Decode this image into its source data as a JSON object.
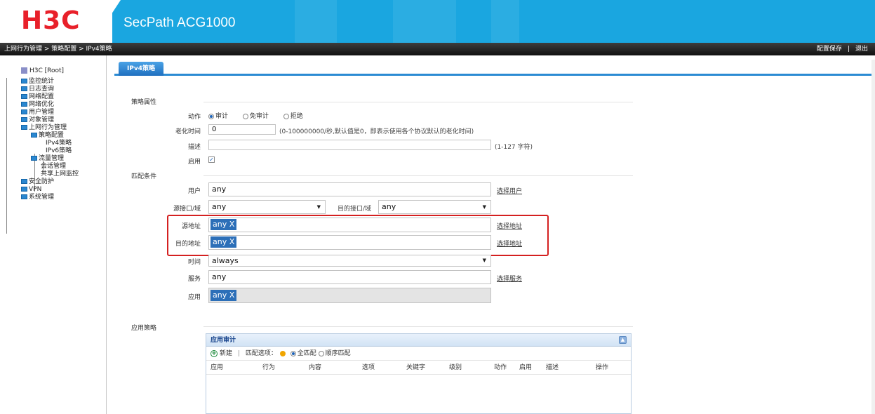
{
  "header": {
    "logo": "H3C",
    "product": "SecPath ACG1000"
  },
  "topbar": {
    "breadcrumb": "上网行为管理 > 策略配置 > IPv4策略",
    "save_label": "配置保存",
    "separator": "|",
    "logout_label": "退出"
  },
  "tree": {
    "root": "H3C [Root]",
    "items": [
      "监控统计",
      "日志查询",
      "网络配置",
      "网络优化",
      "用户管理",
      "对象管理",
      "上网行为管理"
    ],
    "behavior_children": [
      "策略配置",
      "流量管理",
      "会话管理",
      "共享上网监控"
    ],
    "policy_children": [
      "IPv4策略",
      "IPv6策略"
    ],
    "tail_items": [
      "安全防护",
      "VPN",
      "系统管理"
    ]
  },
  "tab": {
    "label": "IPv4策略"
  },
  "policy_props": {
    "section": "策略属性",
    "action_label": "动作",
    "action_options": [
      "审计",
      "免审计",
      "拒绝"
    ],
    "action_selected": "审计",
    "aging_label": "老化时间",
    "aging_value": "0",
    "aging_hint": "(0-100000000/秒,默认值是0，即表示使用各个协议默认的老化时间)",
    "desc_label": "描述",
    "desc_value": "",
    "desc_hint": "(1-127 字符)",
    "enable_label": "启用",
    "enable_checked": true
  },
  "match": {
    "section": "匹配条件",
    "user_label": "用户",
    "user_value": "any",
    "user_link": "选择用户",
    "src_if_label": "源接口/域",
    "src_if_value": "any",
    "dst_if_label": "目的接口/域",
    "dst_if_value": "any",
    "src_addr_label": "源地址",
    "src_addr_tag": "any X",
    "src_addr_link": "选择地址",
    "dst_addr_label": "目的地址",
    "dst_addr_tag": "any X",
    "dst_addr_link": "选择地址",
    "time_label": "时间",
    "time_value": "always",
    "service_label": "服务",
    "service_value": "any",
    "service_link": "选择服务",
    "app_label": "应用",
    "app_tag": "any X"
  },
  "app_policy": {
    "section": "应用策略",
    "panel_title": "应用审计",
    "new_label": "新建",
    "tool_sep": "|",
    "match_label": "匹配选项：",
    "match_options": [
      "全匹配",
      "顺序匹配"
    ],
    "match_selected": "全匹配",
    "columns": [
      "应用",
      "行为",
      "内容",
      "选项",
      "关键字",
      "级别",
      "动作",
      "启用",
      "描述",
      "操作"
    ]
  },
  "colors": {
    "header_blue": "#1aa6e0",
    "logo_red": "#e8202a",
    "tag_blue": "#2c6fb8",
    "highlight_red": "#d42020"
  }
}
